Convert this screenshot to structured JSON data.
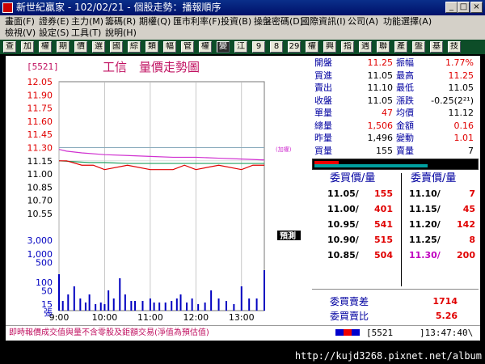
{
  "window": {
    "title": "新世紀贏家 - 102/02/21 - 個股走勢：播報順序",
    "btn_min": "_",
    "btn_max": "□",
    "btn_close": "×"
  },
  "menu": {
    "row1": [
      "畫面(F)",
      "證券(E)",
      "主力(M)",
      "籌碼(R)",
      "期權(Q)",
      "匯市利率(F)",
      "投資(B)",
      "操盤密碼(D)",
      "國際資訊(I)",
      "公司(A)",
      "功能選擇(A)"
    ],
    "row2": [
      "檢視(V)",
      "設定(S)",
      "工具(T)",
      "說明(H)"
    ]
  },
  "toolbar": [
    "查",
    "加",
    "權",
    "期",
    "價",
    "選",
    "國",
    "綜",
    "類",
    "幅",
    "管",
    "權",
    "變",
    "江",
    "9",
    "8",
    "29",
    "權",
    "興",
    "指",
    "遇",
    "聯",
    "產",
    "盤",
    "基",
    "技"
  ],
  "chart_data": {
    "type": "line",
    "stock_code": "5521",
    "title": "工信　量價走勢圖",
    "overlay_label": "預測",
    "buy_price_note": "(加權)",
    "xlim": [
      "9:00",
      "13:30"
    ],
    "x_ticks": [
      "9:00",
      "10:00",
      "11:00",
      "12:00",
      "13:00"
    ],
    "price_ticks": [
      "12.05",
      "11.90",
      "11.75",
      "11.60",
      "11.45",
      "11.30",
      "11.15",
      "11.00",
      "10.85",
      "10.70",
      "10.55"
    ],
    "price_ylim": [
      10.55,
      12.05
    ],
    "reference_price": 11.3,
    "volume_ticks": [
      "3,000",
      "1,000",
      "500",
      "100",
      "50",
      "15",
      "張"
    ],
    "series": [
      {
        "name": "加權",
        "color": "#d030d0",
        "x": [
          "9:00",
          "9:10",
          "9:30",
          "10:00",
          "10:30",
          "11:00",
          "11:30",
          "12:00",
          "12:30",
          "13:00",
          "13:30"
        ],
        "values": [
          11.28,
          11.26,
          11.24,
          11.22,
          11.21,
          11.2,
          11.19,
          11.19,
          11.18,
          11.17,
          11.16
        ]
      },
      {
        "name": "",
        "color": "#20a060",
        "x": [
          "9:00",
          "9:20",
          "9:40",
          "10:00",
          "10:30",
          "11:00",
          "11:30",
          "12:00",
          "12:30",
          "13:00",
          "13:30"
        ],
        "values": [
          11.15,
          11.14,
          11.13,
          11.13,
          11.12,
          11.12,
          11.12,
          11.12,
          11.12,
          11.12,
          11.12
        ]
      },
      {
        "name": "",
        "color": "#e00000",
        "x": [
          "9:00",
          "9:10",
          "9:30",
          "9:45",
          "10:00",
          "10:30",
          "11:00",
          "11:30",
          "11:45",
          "12:00",
          "12:30",
          "13:00",
          "13:15",
          "13:30"
        ],
        "values": [
          11.15,
          11.15,
          11.1,
          11.1,
          11.05,
          11.1,
          11.05,
          11.05,
          11.1,
          11.05,
          11.1,
          11.05,
          11.1,
          11.1
        ]
      }
    ],
    "volume_bars": [
      {
        "x": "9:00",
        "v": 45
      },
      {
        "x": "9:05",
        "v": 12
      },
      {
        "x": "9:12",
        "v": 20
      },
      {
        "x": "9:20",
        "v": 30
      },
      {
        "x": "9:28",
        "v": 15
      },
      {
        "x": "9:35",
        "v": 10
      },
      {
        "x": "9:40",
        "v": 20
      },
      {
        "x": "9:48",
        "v": 8
      },
      {
        "x": "9:55",
        "v": 10
      },
      {
        "x": "10:00",
        "v": 8
      },
      {
        "x": "10:05",
        "v": 25
      },
      {
        "x": "10:12",
        "v": 15
      },
      {
        "x": "10:20",
        "v": 40
      },
      {
        "x": "10:27",
        "v": 20
      },
      {
        "x": "10:35",
        "v": 12
      },
      {
        "x": "10:40",
        "v": 12
      },
      {
        "x": "10:50",
        "v": 12
      },
      {
        "x": "11:00",
        "v": 15
      },
      {
        "x": "11:05",
        "v": 10
      },
      {
        "x": "11:12",
        "v": 10
      },
      {
        "x": "11:20",
        "v": 10
      },
      {
        "x": "11:28",
        "v": 12
      },
      {
        "x": "11:35",
        "v": 15
      },
      {
        "x": "11:40",
        "v": 20
      },
      {
        "x": "11:48",
        "v": 10
      },
      {
        "x": "11:55",
        "v": 15
      },
      {
        "x": "12:03",
        "v": 8
      },
      {
        "x": "12:12",
        "v": 10
      },
      {
        "x": "12:20",
        "v": 25
      },
      {
        "x": "12:30",
        "v": 15
      },
      {
        "x": "12:40",
        "v": 12
      },
      {
        "x": "12:50",
        "v": 8
      },
      {
        "x": "13:00",
        "v": 30
      },
      {
        "x": "13:10",
        "v": 15
      },
      {
        "x": "13:20",
        "v": 15
      },
      {
        "x": "13:30",
        "v": 50
      }
    ]
  },
  "quote": {
    "rows": [
      {
        "l1": "開盤",
        "v1": "11.25",
        "l2": "振幅",
        "v2": "1.77%",
        "c1": "#e00000",
        "c2": "#e00000"
      },
      {
        "l1": "買進",
        "v1": "11.05",
        "l2": "最高",
        "v2": "11.25",
        "c1": "#000",
        "c2": "#e00000"
      },
      {
        "l1": "賣出",
        "v1": "11.10",
        "l2": "最低",
        "v2": "11.05",
        "c1": "#000",
        "c2": "#000"
      },
      {
        "l1": "收盤",
        "v1": "11.05",
        "l2": "漲跌",
        "v2": "-0.25(2²¹)",
        "c1": "#000",
        "c2": "#000"
      },
      {
        "l1": "單量",
        "v1": "47",
        "l2": "均價",
        "v2": "11.12",
        "c1": "#e00000",
        "c2": "#000"
      },
      {
        "l1": "總量",
        "v1": "1,506",
        "l2": "金額",
        "v2": "0.16",
        "c1": "#e00000",
        "c2": "#e00000"
      },
      {
        "l1": "昨量",
        "v1": "1,496",
        "l2": "變動",
        "v2": "1.01",
        "c1": "#000",
        "c2": "#e00000"
      },
      {
        "l1": "買量",
        "v1": "155",
        "l2": "賣量",
        "v2": "7",
        "c1": "#000",
        "c2": "#000"
      }
    ],
    "bid_header": "委買價/量",
    "ask_header": "委賣價/量",
    "bids": [
      {
        "p": "11.05/",
        "q": "155"
      },
      {
        "p": "11.00/",
        "q": "401"
      },
      {
        "p": "10.95/",
        "q": "541"
      },
      {
        "p": "10.90/",
        "q": "515"
      },
      {
        "p": "10.85/",
        "q": "504"
      }
    ],
    "asks": [
      {
        "p": "11.10/",
        "q": "7"
      },
      {
        "p": "11.15/",
        "q": "45"
      },
      {
        "p": "11.20/",
        "q": "142"
      },
      {
        "p": "11.25/",
        "q": "8"
      },
      {
        "p": "11.30/",
        "q": "200"
      }
    ],
    "diff_label": "委買賣差",
    "diff_value": "1714",
    "ratio_label": "委買賣比",
    "ratio_value": "5.26"
  },
  "status": {
    "note": "即時報價成交值與量不含零股及鉅額交易(淨值為預估值)",
    "code": "[5521",
    "time": "]13:47:40\\"
  },
  "footer": {
    "url": "http://kujd3268.pixnet.net/album"
  }
}
